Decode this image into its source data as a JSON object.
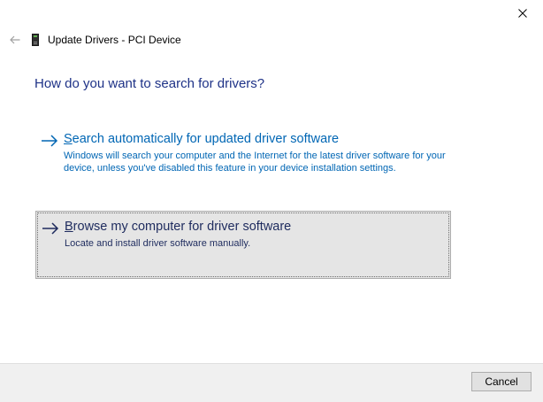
{
  "window": {
    "title": "Update Drivers - PCI Device",
    "close_icon": "close-icon",
    "back_icon": "back-arrow-icon",
    "device_icon": "device-icon"
  },
  "main": {
    "heading": "How do you want to search for drivers?",
    "options": [
      {
        "title_accel": "S",
        "title_rest": "earch automatically for updated driver software",
        "description": "Windows will search your computer and the Internet for the latest driver software for your device, unless you've disabled this feature in your device installation settings.",
        "icon": "arrow-right-icon",
        "selected": false
      },
      {
        "title_accel": "B",
        "title_rest": "rowse my computer for driver software",
        "description": "Locate and install driver software manually.",
        "icon": "arrow-right-icon",
        "selected": true
      }
    ]
  },
  "footer": {
    "cancel_label": "Cancel"
  },
  "colors": {
    "link_blue": "#0066b4",
    "heading_blue": "#1e3287",
    "selected_text": "#1e2b5e",
    "selected_bg": "#e5e5e5",
    "footer_bg": "#f0f0f0"
  }
}
